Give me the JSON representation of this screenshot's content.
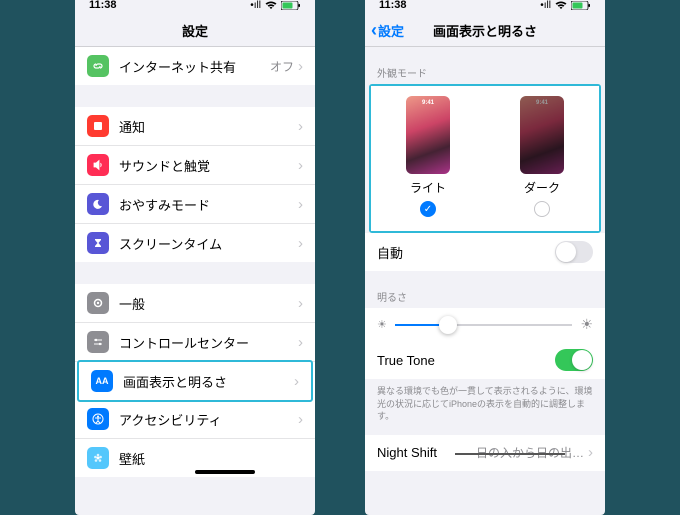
{
  "status": {
    "time": "11:38",
    "signal": "•ıll",
    "wifi": "⁠",
    "battery": "⁠"
  },
  "phone1": {
    "title": "設定",
    "rows": {
      "hotspot": {
        "label": "インターネット共有",
        "value": "オフ"
      },
      "notif": {
        "label": "通知"
      },
      "sound": {
        "label": "サウンドと触覚"
      },
      "dnd": {
        "label": "おやすみモード"
      },
      "screentime": {
        "label": "スクリーンタイム"
      },
      "general": {
        "label": "一般"
      },
      "control": {
        "label": "コントロールセンター"
      },
      "display": {
        "label": "画面表示と明るさ"
      },
      "access": {
        "label": "アクセシビリティ"
      },
      "wall": {
        "label": "壁紙"
      }
    }
  },
  "phone2": {
    "back": "設定",
    "title": "画面表示と明るさ",
    "appearance_header": "外観モード",
    "light": "ライト",
    "dark": "ダーク",
    "thumb_time": "9:41",
    "auto": "自動",
    "brightness_header": "明るさ",
    "truetone": "True Tone",
    "truetone_desc": "異なる環境でも色が一貫して表示されるように、環境光の状況に応じてiPhoneの表示を自動的に調整します。",
    "nightshift": {
      "label": "Night Shift",
      "value": "日の入から日の出…"
    }
  }
}
